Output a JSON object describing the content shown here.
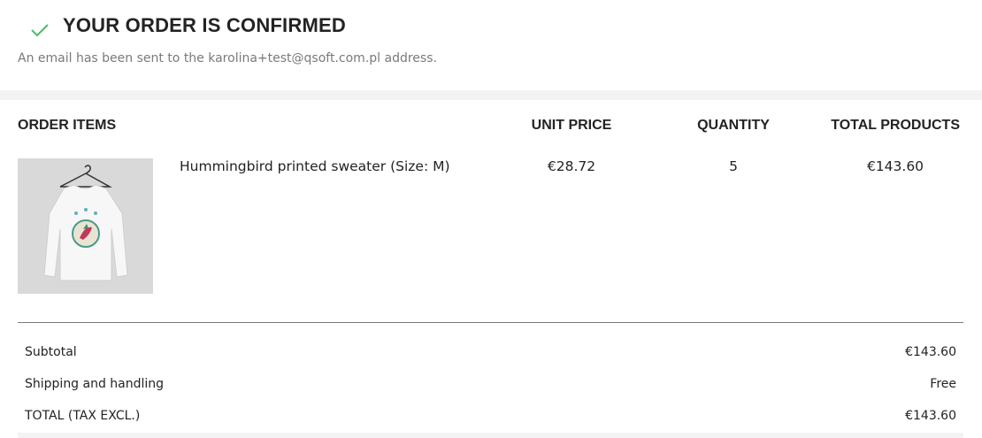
{
  "confirmation": {
    "icon": "check-icon",
    "title": "YOUR ORDER IS CONFIRMED",
    "message": "An email has been sent to the karolina+test@qsoft.com.pl address.",
    "accent_color": "#4cbb6c"
  },
  "order_items": {
    "headers": {
      "items": "ORDER ITEMS",
      "unit_price": "UNIT PRICE",
      "quantity": "QUANTITY",
      "total_products": "TOTAL PRODUCTS"
    },
    "rows": [
      {
        "name": "Hummingbird printed sweater (Size: M)",
        "unit_price": "€28.72",
        "quantity": "5",
        "total": "€143.60"
      }
    ]
  },
  "totals": {
    "subtotal_label": "Subtotal",
    "subtotal_value": "€143.60",
    "shipping_label": "Shipping and handling",
    "shipping_value": "Free",
    "total_label": "TOTAL (TAX EXCL.)",
    "total_value": "€143.60"
  }
}
